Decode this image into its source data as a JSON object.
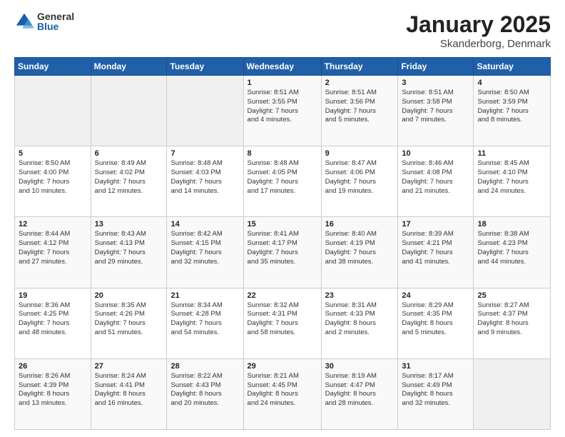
{
  "logo": {
    "general": "General",
    "blue": "Blue"
  },
  "title": "January 2025",
  "subtitle": "Skanderborg, Denmark",
  "weekdays": [
    "Sunday",
    "Monday",
    "Tuesday",
    "Wednesday",
    "Thursday",
    "Friday",
    "Saturday"
  ],
  "weeks": [
    [
      {
        "day": "",
        "info": ""
      },
      {
        "day": "",
        "info": ""
      },
      {
        "day": "",
        "info": ""
      },
      {
        "day": "1",
        "info": "Sunrise: 8:51 AM\nSunset: 3:55 PM\nDaylight: 7 hours\nand 4 minutes."
      },
      {
        "day": "2",
        "info": "Sunrise: 8:51 AM\nSunset: 3:56 PM\nDaylight: 7 hours\nand 5 minutes."
      },
      {
        "day": "3",
        "info": "Sunrise: 8:51 AM\nSunset: 3:58 PM\nDaylight: 7 hours\nand 7 minutes."
      },
      {
        "day": "4",
        "info": "Sunrise: 8:50 AM\nSunset: 3:59 PM\nDaylight: 7 hours\nand 8 minutes."
      }
    ],
    [
      {
        "day": "5",
        "info": "Sunrise: 8:50 AM\nSunset: 4:00 PM\nDaylight: 7 hours\nand 10 minutes."
      },
      {
        "day": "6",
        "info": "Sunrise: 8:49 AM\nSunset: 4:02 PM\nDaylight: 7 hours\nand 12 minutes."
      },
      {
        "day": "7",
        "info": "Sunrise: 8:48 AM\nSunset: 4:03 PM\nDaylight: 7 hours\nand 14 minutes."
      },
      {
        "day": "8",
        "info": "Sunrise: 8:48 AM\nSunset: 4:05 PM\nDaylight: 7 hours\nand 17 minutes."
      },
      {
        "day": "9",
        "info": "Sunrise: 8:47 AM\nSunset: 4:06 PM\nDaylight: 7 hours\nand 19 minutes."
      },
      {
        "day": "10",
        "info": "Sunrise: 8:46 AM\nSunset: 4:08 PM\nDaylight: 7 hours\nand 21 minutes."
      },
      {
        "day": "11",
        "info": "Sunrise: 8:45 AM\nSunset: 4:10 PM\nDaylight: 7 hours\nand 24 minutes."
      }
    ],
    [
      {
        "day": "12",
        "info": "Sunrise: 8:44 AM\nSunset: 4:12 PM\nDaylight: 7 hours\nand 27 minutes."
      },
      {
        "day": "13",
        "info": "Sunrise: 8:43 AM\nSunset: 4:13 PM\nDaylight: 7 hours\nand 29 minutes."
      },
      {
        "day": "14",
        "info": "Sunrise: 8:42 AM\nSunset: 4:15 PM\nDaylight: 7 hours\nand 32 minutes."
      },
      {
        "day": "15",
        "info": "Sunrise: 8:41 AM\nSunset: 4:17 PM\nDaylight: 7 hours\nand 35 minutes."
      },
      {
        "day": "16",
        "info": "Sunrise: 8:40 AM\nSunset: 4:19 PM\nDaylight: 7 hours\nand 38 minutes."
      },
      {
        "day": "17",
        "info": "Sunrise: 8:39 AM\nSunset: 4:21 PM\nDaylight: 7 hours\nand 41 minutes."
      },
      {
        "day": "18",
        "info": "Sunrise: 8:38 AM\nSunset: 4:23 PM\nDaylight: 7 hours\nand 44 minutes."
      }
    ],
    [
      {
        "day": "19",
        "info": "Sunrise: 8:36 AM\nSunset: 4:25 PM\nDaylight: 7 hours\nand 48 minutes."
      },
      {
        "day": "20",
        "info": "Sunrise: 8:35 AM\nSunset: 4:26 PM\nDaylight: 7 hours\nand 51 minutes."
      },
      {
        "day": "21",
        "info": "Sunrise: 8:34 AM\nSunset: 4:28 PM\nDaylight: 7 hours\nand 54 minutes."
      },
      {
        "day": "22",
        "info": "Sunrise: 8:32 AM\nSunset: 4:31 PM\nDaylight: 7 hours\nand 58 minutes."
      },
      {
        "day": "23",
        "info": "Sunrise: 8:31 AM\nSunset: 4:33 PM\nDaylight: 8 hours\nand 2 minutes."
      },
      {
        "day": "24",
        "info": "Sunrise: 8:29 AM\nSunset: 4:35 PM\nDaylight: 8 hours\nand 5 minutes."
      },
      {
        "day": "25",
        "info": "Sunrise: 8:27 AM\nSunset: 4:37 PM\nDaylight: 8 hours\nand 9 minutes."
      }
    ],
    [
      {
        "day": "26",
        "info": "Sunrise: 8:26 AM\nSunset: 4:39 PM\nDaylight: 8 hours\nand 13 minutes."
      },
      {
        "day": "27",
        "info": "Sunrise: 8:24 AM\nSunset: 4:41 PM\nDaylight: 8 hours\nand 16 minutes."
      },
      {
        "day": "28",
        "info": "Sunrise: 8:22 AM\nSunset: 4:43 PM\nDaylight: 8 hours\nand 20 minutes."
      },
      {
        "day": "29",
        "info": "Sunrise: 8:21 AM\nSunset: 4:45 PM\nDaylight: 8 hours\nand 24 minutes."
      },
      {
        "day": "30",
        "info": "Sunrise: 8:19 AM\nSunset: 4:47 PM\nDaylight: 8 hours\nand 28 minutes."
      },
      {
        "day": "31",
        "info": "Sunrise: 8:17 AM\nSunset: 4:49 PM\nDaylight: 8 hours\nand 32 minutes."
      },
      {
        "day": "",
        "info": ""
      }
    ]
  ]
}
